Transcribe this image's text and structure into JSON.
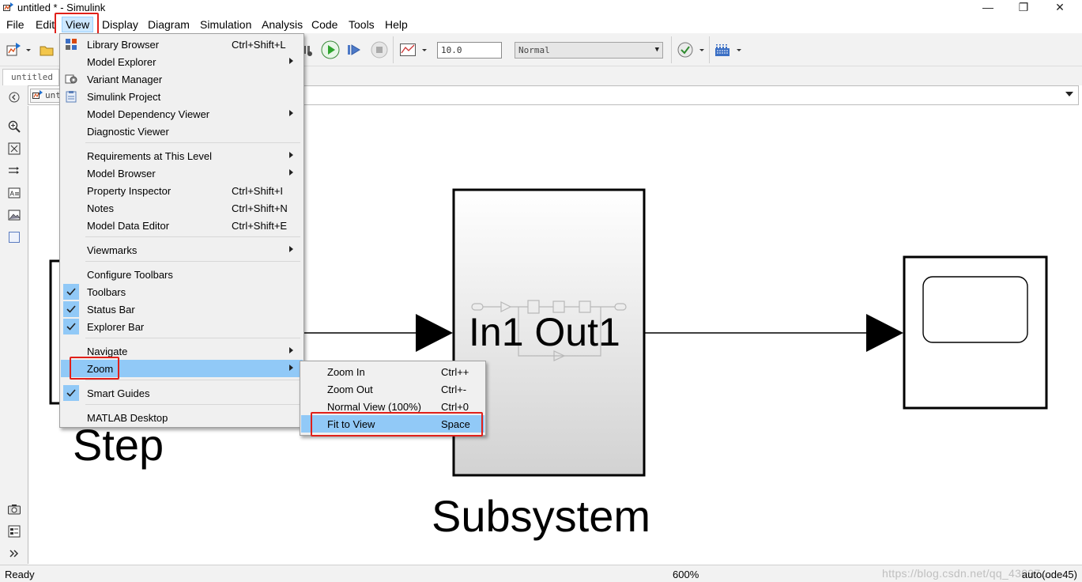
{
  "window": {
    "title": "untitled * - Simulink",
    "controls": [
      "—",
      "❐",
      "✕"
    ]
  },
  "menubar": [
    "File",
    "Edit",
    "View",
    "Display",
    "Diagram",
    "Simulation",
    "Analysis",
    "Code",
    "Tools",
    "Help"
  ],
  "toolbar": {
    "stop_time": "10.0",
    "sim_mode": "Normal"
  },
  "tab": {
    "label": "untitled"
  },
  "explorer": {
    "crumb": "unt"
  },
  "view_menu": {
    "items": [
      {
        "label": "Library Browser",
        "shortcut": "Ctrl+Shift+L",
        "icon": "library-browser-icon"
      },
      {
        "label": "Model Explorer",
        "submenu": true
      },
      {
        "label": "Variant Manager",
        "icon": "variant-manager-icon"
      },
      {
        "label": "Simulink Project",
        "icon": "simulink-project-icon"
      },
      {
        "label": "Model Dependency Viewer",
        "submenu": true
      },
      {
        "label": "Diagnostic Viewer"
      },
      {
        "label": "Requirements at This Level",
        "submenu": true
      },
      {
        "label": "Model Browser",
        "submenu": true
      },
      {
        "label": "Property Inspector",
        "shortcut": "Ctrl+Shift+I"
      },
      {
        "label": "Notes",
        "shortcut": "Ctrl+Shift+N"
      },
      {
        "label": "Model Data Editor",
        "shortcut": "Ctrl+Shift+E"
      },
      {
        "label": "Viewmarks",
        "submenu": true
      },
      {
        "label": "Configure Toolbars"
      },
      {
        "label": "Toolbars",
        "checked": true
      },
      {
        "label": "Status Bar",
        "checked": true
      },
      {
        "label": "Explorer Bar",
        "checked": true
      },
      {
        "label": "Navigate",
        "submenu": true
      },
      {
        "label": "Zoom",
        "submenu": true,
        "selected": true
      },
      {
        "label": "Smart Guides",
        "checked": true
      },
      {
        "label": "MATLAB Desktop"
      }
    ]
  },
  "zoom_menu": {
    "items": [
      {
        "label": "Zoom In",
        "shortcut": "Ctrl++"
      },
      {
        "label": "Zoom Out",
        "shortcut": "Ctrl+-"
      },
      {
        "label": "Normal View (100%)",
        "shortcut": "Ctrl+0"
      },
      {
        "label": "Fit to View",
        "shortcut": "Space",
        "selected": true
      }
    ]
  },
  "diagram": {
    "step_label": "Step",
    "subsystem_label": "Subsystem",
    "subsystem_ports": "In1 Out1"
  },
  "statusbar": {
    "status": "Ready",
    "zoom": "600%",
    "solver": "auto(ode45)",
    "watermark": "https://blog.csdn.net/qq_43097..."
  },
  "colors": {
    "highlight_red": "#e0201a",
    "menu_selected": "#91c9f7",
    "run_green": "#2fa52f"
  }
}
